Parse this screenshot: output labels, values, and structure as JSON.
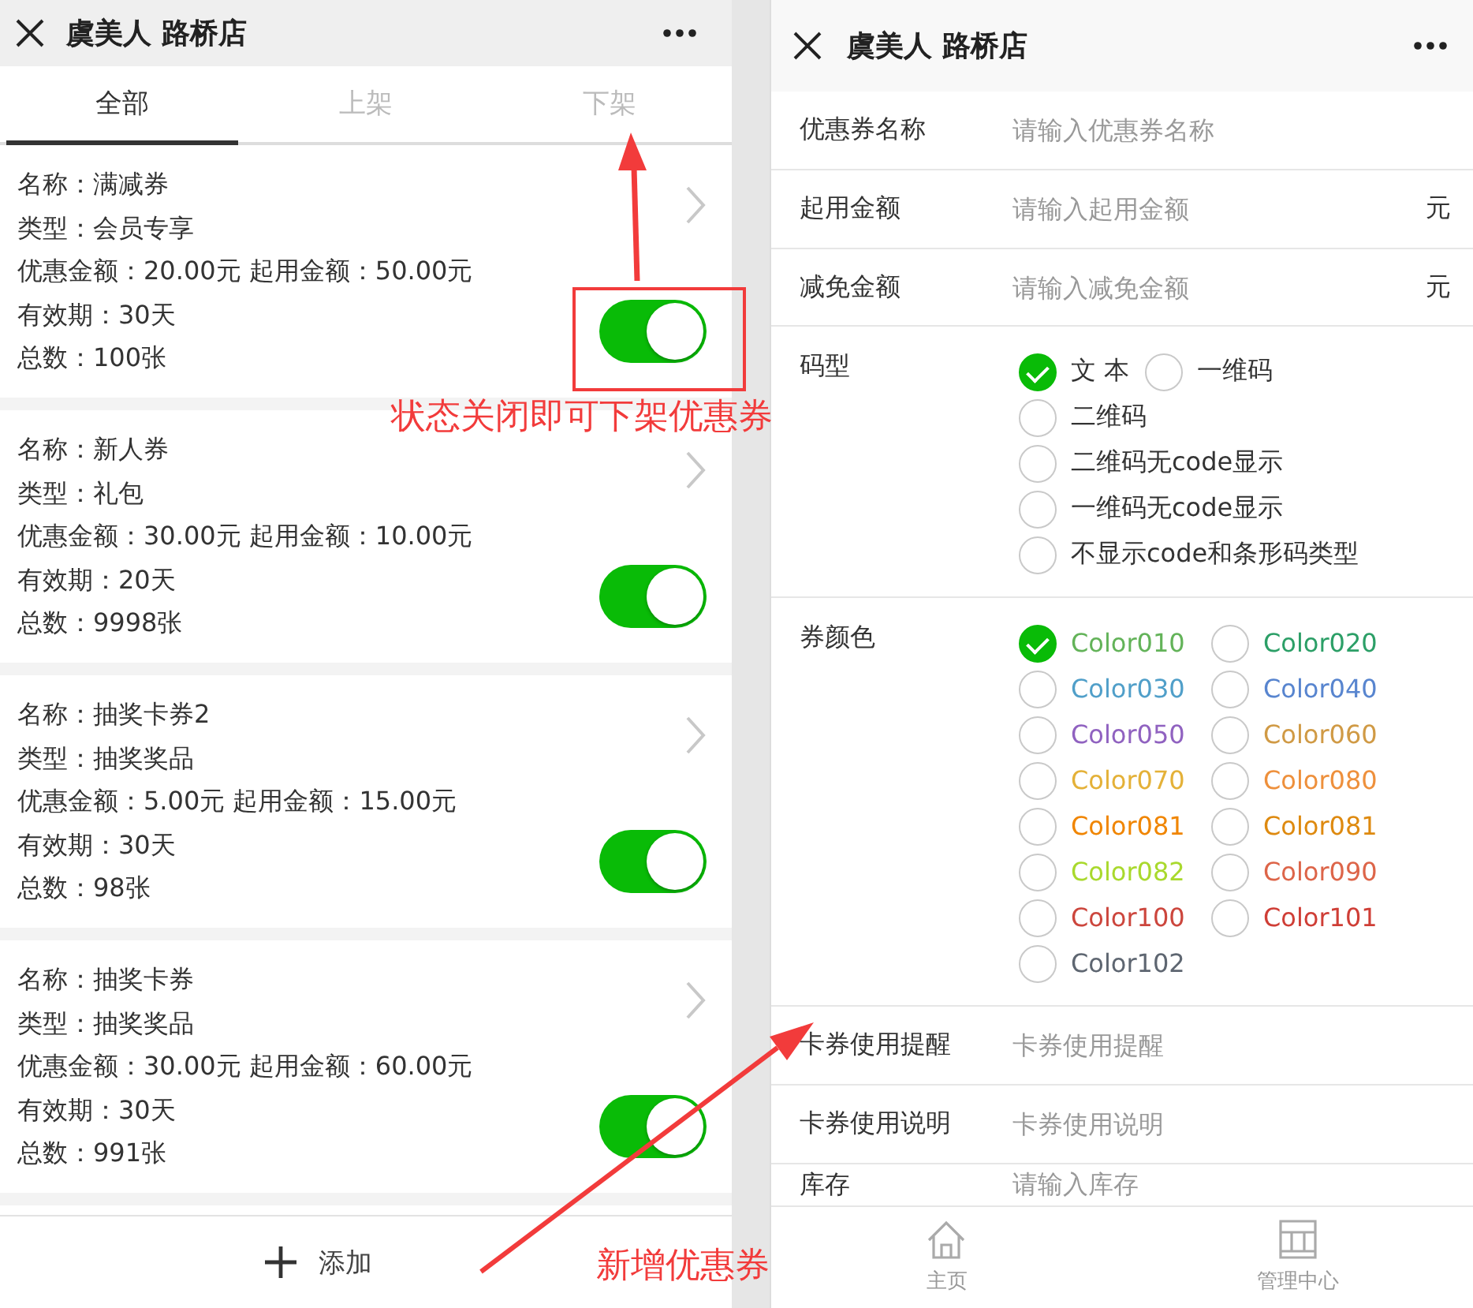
{
  "list_screen": {
    "title": "虞美人 路桥店",
    "tabs": [
      {
        "label": "全部",
        "selected": true
      },
      {
        "label": "上架",
        "selected": false
      },
      {
        "label": "下架",
        "selected": false
      }
    ],
    "coupons": [
      {
        "lines": [
          "名称：满减券",
          "类型：会员专享",
          "优惠金额：20.00元 起用金额：50.00元",
          "有效期：30天",
          "总数：100张"
        ],
        "on": true
      },
      {
        "lines": [
          "名称：新人券",
          "类型：礼包",
          "优惠金额：30.00元 起用金额：10.00元",
          "有效期：20天",
          "总数：9998张"
        ],
        "on": true
      },
      {
        "lines": [
          "名称：抽奖卡券2",
          "类型：抽奖奖品",
          "优惠金额：5.00元 起用金额：15.00元",
          "有效期：30天",
          "总数：98张"
        ],
        "on": true
      },
      {
        "lines": [
          "名称：抽奖卡券",
          "类型：抽奖奖品",
          "优惠金额：30.00元 起用金额：60.00元",
          "有效期：30天",
          "总数：991张"
        ],
        "on": true
      }
    ],
    "add_button": "添加"
  },
  "form_screen": {
    "title": "虞美人 路桥店",
    "rows": [
      {
        "kind": "input",
        "label": "优惠券名称",
        "placeholder": "请输入优惠券名称"
      },
      {
        "kind": "input",
        "label": "起用金额",
        "placeholder": "请输入起用金额",
        "unit": "元"
      },
      {
        "kind": "input",
        "label": "减免金额",
        "placeholder": "请输入减免金额",
        "unit": "元"
      },
      {
        "kind": "code_type",
        "label": "码型",
        "options": [
          {
            "label": "文 本",
            "selected": true
          },
          {
            "label": "一维码",
            "selected": false
          },
          {
            "label": "二维码",
            "selected": false
          },
          {
            "label": "二维码无code显示",
            "selected": false
          },
          {
            "label": "一维码无code显示",
            "selected": false
          },
          {
            "label": "不显示code和条形码类型",
            "selected": false
          }
        ]
      },
      {
        "kind": "color",
        "label": "券颜色",
        "options": [
          {
            "label": "Color010",
            "color": "#63b359",
            "selected": true
          },
          {
            "label": "Color020",
            "color": "#2c9f67",
            "selected": false
          },
          {
            "label": "Color030",
            "color": "#509fc9",
            "selected": false
          },
          {
            "label": "Color040",
            "color": "#5885cf",
            "selected": false
          },
          {
            "label": "Color050",
            "color": "#9062c0",
            "selected": false
          },
          {
            "label": "Color060",
            "color": "#d09a45",
            "selected": false
          },
          {
            "label": "Color070",
            "color": "#e4b138",
            "selected": false
          },
          {
            "label": "Color080",
            "color": "#ee903c",
            "selected": false
          },
          {
            "label": "Color081",
            "color": "#f08500",
            "selected": false
          },
          {
            "label": "Color081",
            "color": "#de8a10",
            "selected": false
          },
          {
            "label": "Color082",
            "color": "#a9d92d",
            "selected": false
          },
          {
            "label": "Color090",
            "color": "#dd6549",
            "selected": false
          },
          {
            "label": "Color100",
            "color": "#cc463d",
            "selected": false
          },
          {
            "label": "Color101",
            "color": "#cf3e36",
            "selected": false
          },
          {
            "label": "Color102",
            "color": "#5e6671",
            "selected": false
          }
        ]
      },
      {
        "kind": "input",
        "label": "卡券使用提醒",
        "placeholder": "卡券使用提醒"
      },
      {
        "kind": "input",
        "label": "卡券使用说明",
        "placeholder": "卡券使用说明"
      },
      {
        "kind": "input",
        "label": "库存",
        "placeholder": "请输入库存"
      }
    ],
    "tab_bar": [
      {
        "label": "主页",
        "kind": "home"
      },
      {
        "label": "管理中心",
        "kind": "shop"
      }
    ]
  },
  "annotations": {
    "toggle_note": "状态关闭即可下架优惠券",
    "add_note": "新增优惠券"
  }
}
